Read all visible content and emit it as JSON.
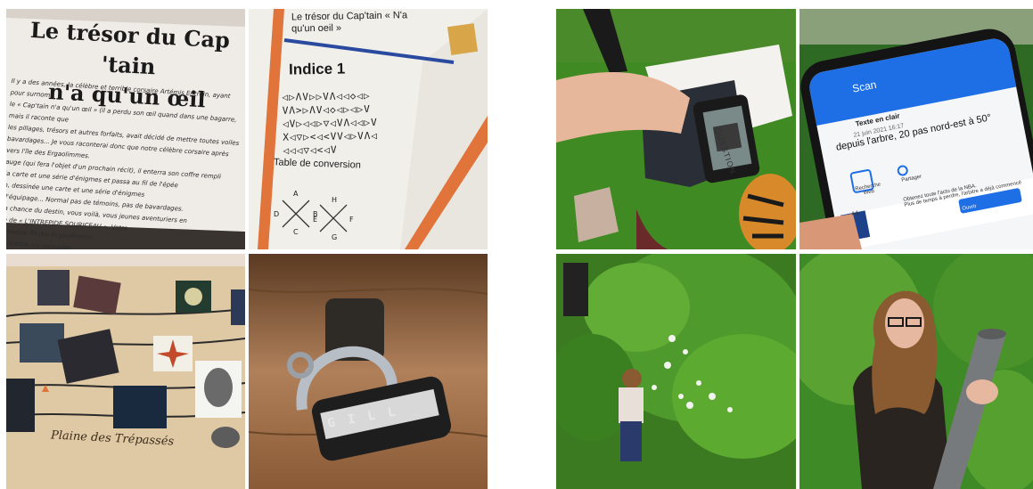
{
  "collage": {
    "photo1": {
      "title": "Le trésor du Cap 'tain\nn'a qu'un œil",
      "body": "Il y a des années, la célèbre et terrible corsaire Artémis Entrein, ayant pour surnom\nle « Cap'tain n'a qu'un œil » (il a perdu son œil quand dans une bagarre, mais il raconte que\nles pillages, trésors et autres forfaits, avait décidé de mettre toutes voiles\nbavardages... Je vous raconterai donc que notre célèbre corsaire après\nvers l'île des Ergaolimmes.\nauge (qui fera l'objet d'un prochain récit), il enterra son coffre rempli\nla carte et une série d'énigmes et passa au fil de l'épée\nn, dessinée une carte et une série d'énigmes\nd'équipage... Normal pas de témoins, pas de bavardages.\nla chance du destin, vous voilà, vous jeunes aventuriers en\nle de « L'INTREPIDE SOURICEAU ». Votre\nfameuse île des Ergaolimmes.\nombattre les sauvages"
    },
    "photo2": {
      "heading": "Le trésor du Cap'tain « N'a\nqu'un oeil »",
      "indice": "Indice 1",
      "cipher": "◁▷ΛV▷▷VΛ◁◁◇◁▷\nVΛ>▷ΛV◁◇◁▷◁▷V\n◁V▷◁◁▷▽◁VΛ◁◁▷V\nX◁▽▷<◁<VV◁▷VΛ◁\n◁◁◁▽◁<◁V",
      "table_label": "Table de conversion",
      "letters": [
        "A",
        "B",
        "C",
        "D",
        "E",
        "F",
        "G",
        "H"
      ]
    },
    "photo3": {
      "plaine_label": "Plaine des Trépassés"
    },
    "photo4": {
      "lock_letters": "G I L L"
    },
    "photo5": {
      "qr_text": "QUESTION"
    },
    "photo6": {
      "app_title": "Scan",
      "result_type": "Texte en clair",
      "result_date": "21 juin 2021 16:17",
      "result_text": "depuis l'arbre, 20 pas nord-est à 50°",
      "action_search": "Recherche\nWeb",
      "action_share": "Partager",
      "ad_label": "Ad",
      "ad_text": "Obtenez toute l'actu de la NBA.\nPlus de temps à perdre, l'arbitre a déjà commencé",
      "ad_button": "Ouvrir"
    },
    "photo7": {},
    "photo8": {}
  },
  "colors": {
    "paper": "#efebe6",
    "map": "#dfc8a4",
    "grass": "#3f8a22",
    "app_blue": "#1e6ee6",
    "orange_bar": "#e0743a"
  }
}
